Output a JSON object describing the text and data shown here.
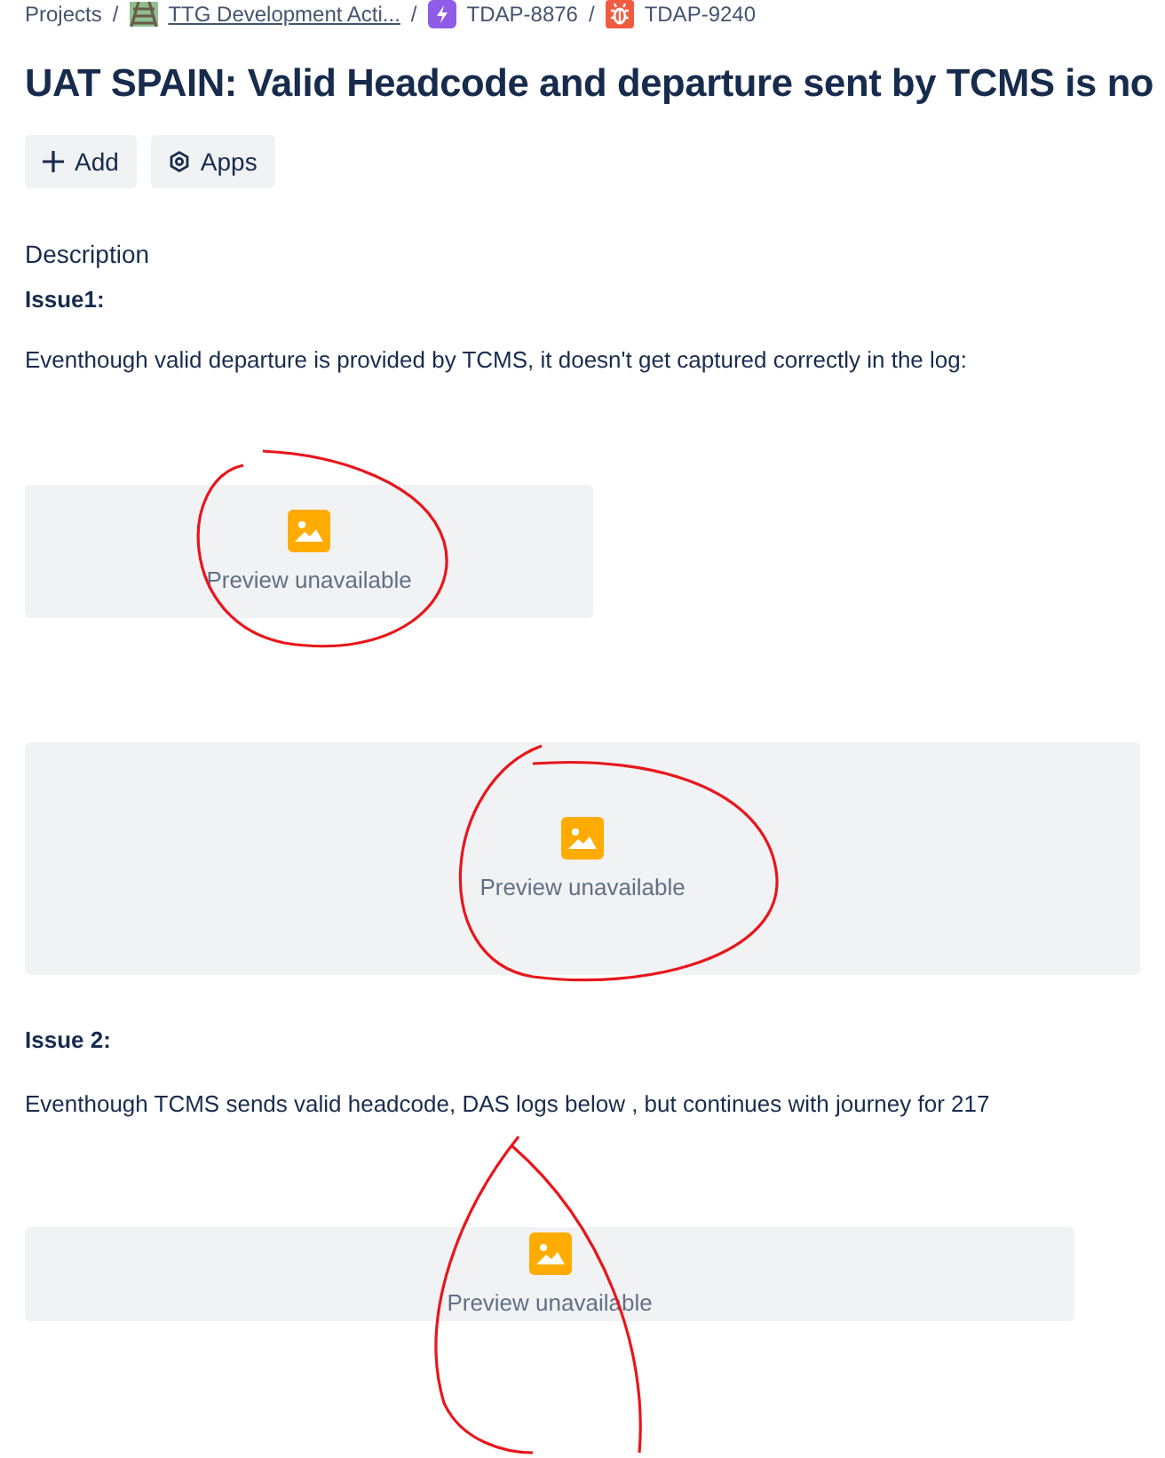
{
  "breadcrumbs": [
    {
      "label": "Projects",
      "kind": "text"
    },
    {
      "label": "TTG Development Acti...",
      "kind": "project"
    },
    {
      "label": "TDAP-8876",
      "kind": "epic"
    },
    {
      "label": "TDAP-9240",
      "kind": "bug"
    }
  ],
  "separator": "/",
  "title": "UAT SPAIN: Valid Headcode and departure sent by TCMS is no",
  "actions": [
    {
      "label": "Add",
      "kind": "add"
    },
    {
      "label": "Apps",
      "kind": "apps"
    }
  ],
  "description": {
    "heading": "Description",
    "blocks": [
      {
        "kind": "bold",
        "text": "Issue1:"
      },
      {
        "kind": "paragraph",
        "text": "Eventhough valid departure is provided by TCMS, it doesn't get captured correctly in the log:"
      },
      {
        "kind": "preview",
        "label": "Preview unavailable"
      },
      {
        "kind": "preview",
        "label": "Preview unavailable"
      },
      {
        "kind": "bold",
        "text": "Issue 2:"
      },
      {
        "kind": "paragraph",
        "text": "Eventhough TCMS sends valid headcode, DAS logs below , but continues with journey for 217"
      },
      {
        "kind": "preview",
        "label": "Preview unavailable"
      }
    ]
  }
}
